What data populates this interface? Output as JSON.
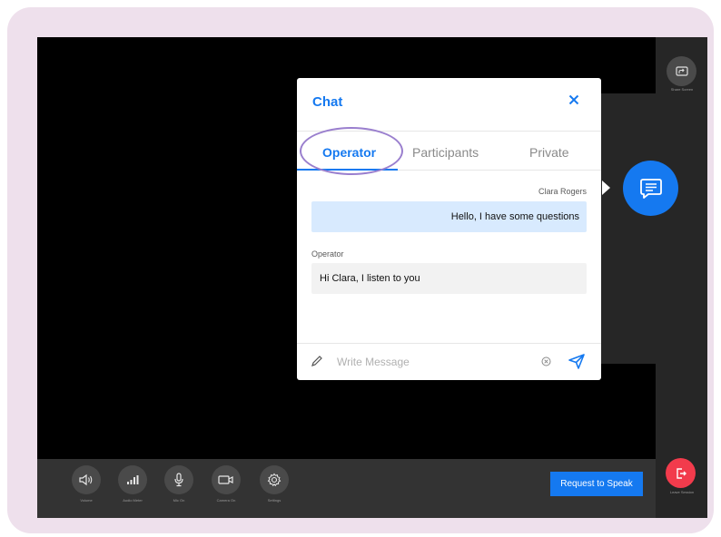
{
  "right_bar": {
    "share_screen_label": "Share Screen",
    "leave_label": "Leave Session"
  },
  "controls": [
    {
      "label": "Volume",
      "icon": "volume-icon"
    },
    {
      "label": "Audio Meter",
      "icon": "audio-meter-icon"
    },
    {
      "label": "Mic On",
      "icon": "microphone-icon"
    },
    {
      "label": "Camera On",
      "icon": "camera-icon"
    },
    {
      "label": "Settings",
      "icon": "gear-icon"
    }
  ],
  "request_button_label": "Request to Speak",
  "chat": {
    "title": "Chat",
    "tabs": [
      {
        "label": "Operator",
        "active": true
      },
      {
        "label": "Participants",
        "active": false
      },
      {
        "label": "Private",
        "active": false
      }
    ],
    "messages": [
      {
        "sender": "Clara Rogers",
        "text": "Hello, I have some questions",
        "side": "right"
      },
      {
        "sender": "Operator",
        "text": "Hi Clara, I listen to you",
        "side": "left"
      }
    ],
    "input_placeholder": "Write Message"
  },
  "colors": {
    "accent": "#1579f0",
    "leave": "#f23b4c",
    "highlight": "#9a7fce",
    "frame": "#eee0ec"
  }
}
